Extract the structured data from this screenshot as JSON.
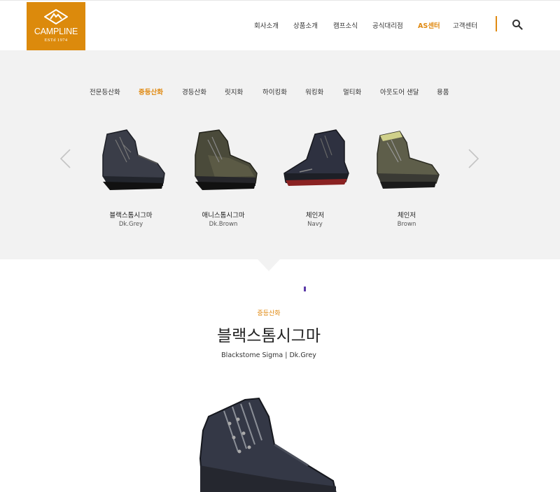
{
  "brand": {
    "name": "CAMPLINE",
    "est": "ESTd 1974",
    "color": "#dc8a0c"
  },
  "nav": {
    "items": [
      {
        "label": "회사소개",
        "active": false
      },
      {
        "label": "상품소개",
        "active": false
      },
      {
        "label": "캠프소식",
        "active": false
      },
      {
        "label": "공식대리점",
        "active": false
      },
      {
        "label": "AS센터",
        "active": true
      },
      {
        "label": "고객센터",
        "active": false
      }
    ],
    "search_icon": "search-icon"
  },
  "categories": [
    {
      "label": "전문등산화",
      "active": false
    },
    {
      "label": "중등산화",
      "active": true
    },
    {
      "label": "경등산화",
      "active": false
    },
    {
      "label": "릿지화",
      "active": false
    },
    {
      "label": "하이킹화",
      "active": false
    },
    {
      "label": "워킹화",
      "active": false
    },
    {
      "label": "멀티화",
      "active": false
    },
    {
      "label": "아웃도어 샌달",
      "active": false
    },
    {
      "label": "용품",
      "active": false
    }
  ],
  "carousel": {
    "prev_icon": "chevron-left-icon",
    "next_icon": "chevron-right-icon",
    "products": [
      {
        "name": "블랙스톰시그마",
        "color": "Dk.Grey"
      },
      {
        "name": "애니스톰시그마",
        "color": "Dk.Brown"
      },
      {
        "name": "체인저",
        "color": "Navy"
      },
      {
        "name": "체인저",
        "color": "Brown"
      }
    ]
  },
  "detail": {
    "category": "중등산화",
    "title": "블랙스톰시그마",
    "subtitle": "Blackstome Sigma | Dk.Grey"
  },
  "colors": {
    "accent": "#e08a12",
    "section_bg": "#f2f2f2",
    "marker": "#5c3ba8"
  }
}
